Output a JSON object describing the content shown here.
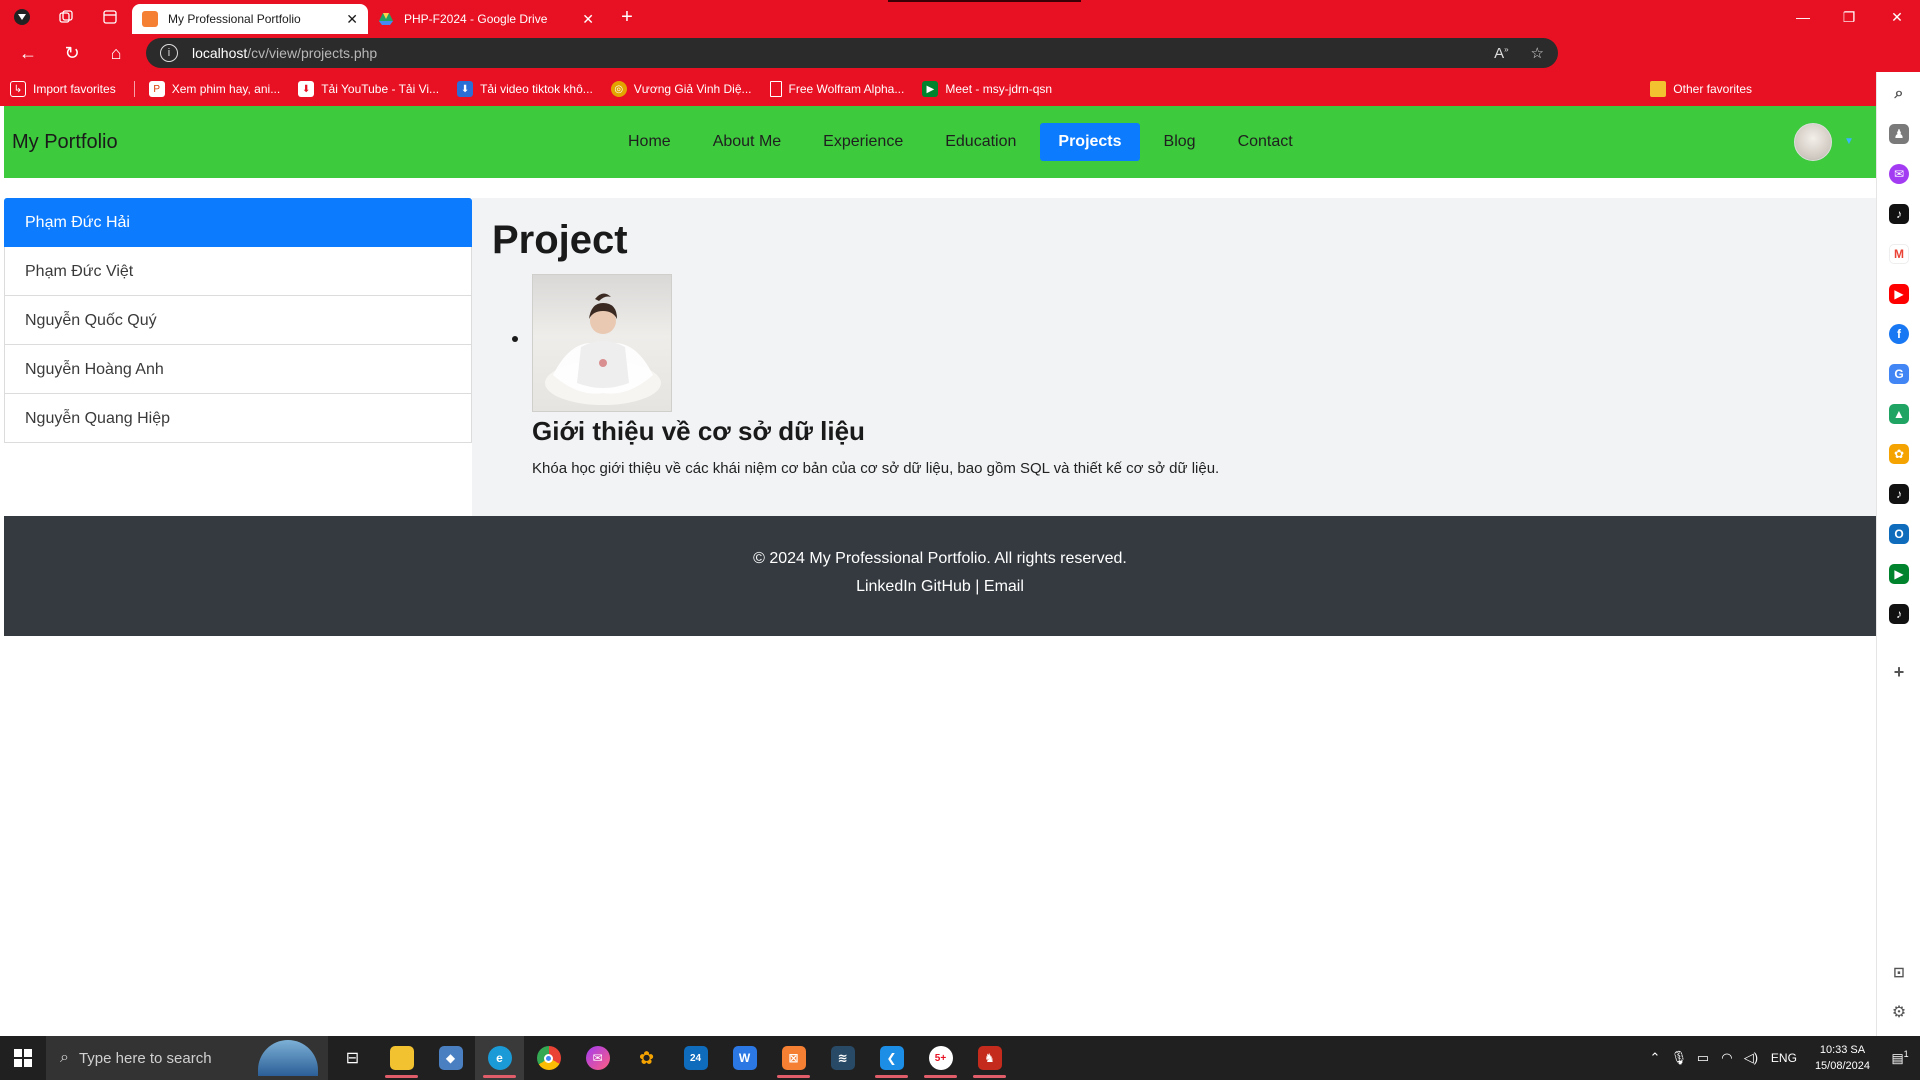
{
  "browser": {
    "tabs": [
      {
        "title": "My Professional Portfolio",
        "active": true,
        "favicon_color": "#f57f33"
      },
      {
        "title": "PHP-F2024 - Google Drive",
        "active": false,
        "favicon_color": "#1fa463"
      }
    ],
    "url": {
      "host": "localhost",
      "path": "/cv/view/projects.php"
    },
    "favorites": [
      {
        "label": "Import favorites",
        "icon": "import-icon"
      },
      {
        "label": "Xem phim hay, ani...",
        "icon": "film-icon",
        "color": "#d83b01"
      },
      {
        "label": "Tải YouTube - Tải Vi...",
        "icon": "download-icon",
        "color": "#e81123"
      },
      {
        "label": "Tải video tiktok khô...",
        "icon": "download-icon",
        "color": "#2b6fd6"
      },
      {
        "label": "Vương Giả Vinh Diệ...",
        "icon": "game-icon",
        "color": "#e3a400"
      },
      {
        "label": "Free Wolfram Alpha...",
        "icon": "page-icon"
      },
      {
        "label": "Meet - msy-jdrn-qsn",
        "icon": "meet-icon",
        "color": "#00832d"
      }
    ],
    "other_favorites": "Other favorites"
  },
  "site": {
    "brand": "My Portfolio",
    "nav": [
      {
        "label": "Home",
        "active": false
      },
      {
        "label": "About Me",
        "active": false
      },
      {
        "label": "Experience",
        "active": false
      },
      {
        "label": "Education",
        "active": false
      },
      {
        "label": "Projects",
        "active": true
      },
      {
        "label": "Blog",
        "active": false
      },
      {
        "label": "Contact",
        "active": false
      }
    ],
    "people": [
      {
        "name": "Phạm Đức Hải",
        "active": true
      },
      {
        "name": "Phạm Đức Việt",
        "active": false
      },
      {
        "name": "Nguyễn Quốc Quý",
        "active": false
      },
      {
        "name": "Nguyễn Hoàng Anh",
        "active": false
      },
      {
        "name": "Nguyễn Quang Hiệp",
        "active": false
      }
    ],
    "page_title": "Project",
    "project": {
      "title": "Giới thiệu về cơ sở dữ liệu",
      "description": "Khóa học giới thiệu về các khái niệm cơ bản của cơ sở dữ liệu, bao gồm SQL và thiết kế cơ sở dữ liệu."
    },
    "footer": {
      "copyright": "© 2024 My Professional Portfolio. All rights reserved.",
      "links": [
        "LinkedIn",
        "GitHub",
        "Email"
      ],
      "separator": "|"
    }
  },
  "taskbar": {
    "search_placeholder": "Type here to search",
    "language": "ENG",
    "time": "10:33 SA",
    "date": "15/08/2024",
    "notification_count": "1",
    "apps": [
      {
        "name": "task-view",
        "color": "#202020",
        "glyph": "▯"
      },
      {
        "name": "file-explorer",
        "color": "#f2c230",
        "glyph": "▭"
      },
      {
        "name": "app-blue",
        "color": "#4a7fc1",
        "glyph": "◆"
      },
      {
        "name": "edge",
        "color": "#1a9bd7",
        "glyph": "e"
      },
      {
        "name": "chrome",
        "color": "#e8453c",
        "glyph": "●"
      },
      {
        "name": "messenger",
        "color": "#a23bf2",
        "glyph": "✉"
      },
      {
        "name": "photos",
        "color": "#f4a300",
        "glyph": "✿"
      },
      {
        "name": "mail",
        "color": "#0f6cbd",
        "glyph": "24"
      },
      {
        "name": "wps",
        "color": "#2b78e4",
        "glyph": "W"
      },
      {
        "name": "xampp",
        "color": "#f57f33",
        "glyph": "⊠"
      },
      {
        "name": "mysql-workbench",
        "color": "#284a66",
        "glyph": "≋"
      },
      {
        "name": "vscode",
        "color": "#1c8ee6",
        "glyph": "❮"
      },
      {
        "name": "zalo-like",
        "color": "#ffffff",
        "glyph": "5+"
      },
      {
        "name": "app-red",
        "color": "#c42b1c",
        "glyph": "♞"
      }
    ]
  },
  "colors": {
    "browser_frame": "#e81123",
    "navbar": "#3dca3d",
    "active_blue": "#0d7bfd",
    "footer": "#343a40",
    "main_bg": "#f1f3f5"
  }
}
